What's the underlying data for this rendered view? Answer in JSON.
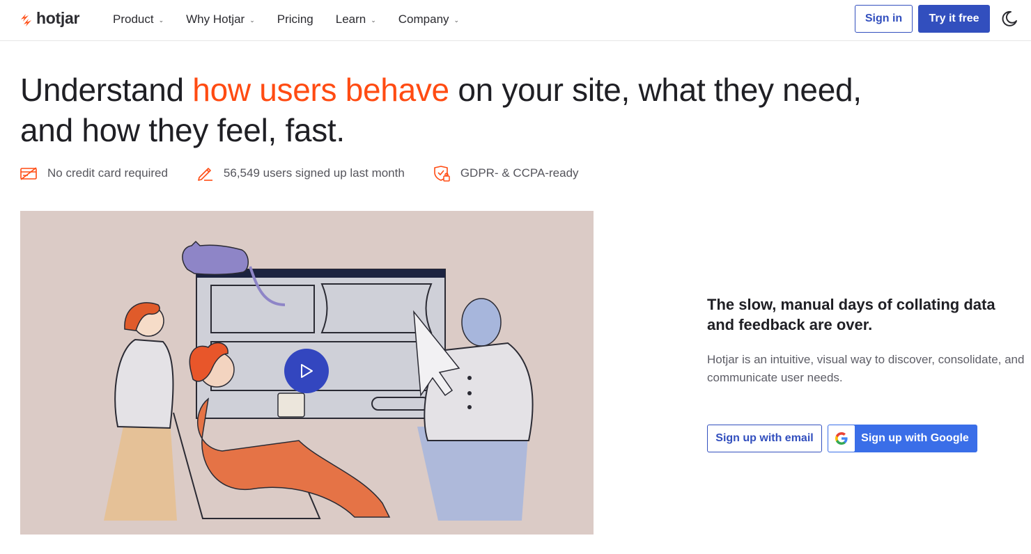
{
  "header": {
    "logo_text": "hotjar",
    "nav": [
      {
        "label": "Product",
        "has_dropdown": true
      },
      {
        "label": "Why Hotjar",
        "has_dropdown": true
      },
      {
        "label": "Pricing",
        "has_dropdown": false
      },
      {
        "label": "Learn",
        "has_dropdown": true
      },
      {
        "label": "Company",
        "has_dropdown": true
      }
    ],
    "sign_in_label": "Sign in",
    "try_free_label": "Try it free",
    "theme_icon": "moon-icon"
  },
  "hero": {
    "headline_before": "Understand ",
    "headline_accent": "how users behave",
    "headline_after": " on your site, what they need, and how they feel, fast.",
    "features": [
      {
        "icon": "credit-card-crossed-icon",
        "label": "No credit card required"
      },
      {
        "icon": "pencil-icon",
        "label": "56,549 users signed up last month"
      },
      {
        "icon": "shield-lock-icon",
        "label": "GDPR- & CCPA-ready"
      }
    ]
  },
  "video": {
    "play_icon": "play-icon"
  },
  "side": {
    "heading": "The slow, manual days of collating data and feedback are over.",
    "text": "Hotjar is an intuitive, visual way to discover, consolidate, and communicate user needs.",
    "email_button_label": "Sign up with email",
    "google_button_label": "Sign up with Google"
  },
  "colors": {
    "brand_orange": "#ff4b12",
    "primary_blue": "#324fbe",
    "google_blue": "#3a6ee8",
    "video_background": "#dbcbc6"
  }
}
